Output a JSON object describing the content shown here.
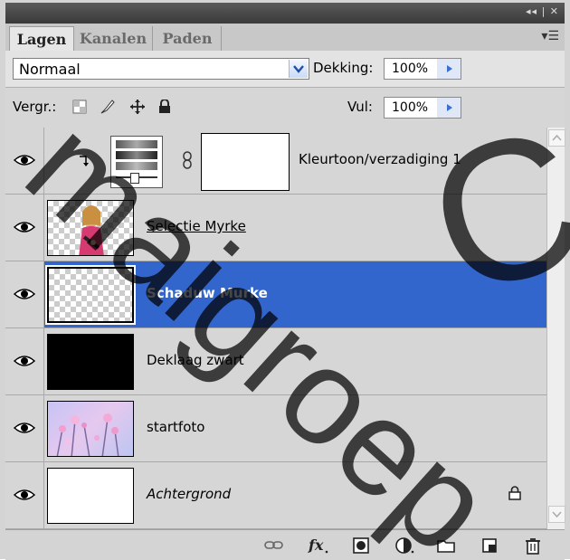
{
  "panel": {
    "tabs": [
      {
        "label": "Lagen"
      },
      {
        "label": "Kanalen"
      },
      {
        "label": "Paden"
      }
    ]
  },
  "options": {
    "blend_mode": "Normaal",
    "opacity_label": "Dekking:",
    "opacity_value": "100%",
    "lock_label": "Vergr.:",
    "fill_label": "Vul:",
    "fill_value": "100%"
  },
  "layers": [
    {
      "name": "Kleurtoon/verzadiging 1",
      "type": "adjustment",
      "visible": true
    },
    {
      "name": "Selectie Myrke",
      "type": "image",
      "visible": true
    },
    {
      "name": "Schaduw Murke",
      "type": "transparent",
      "visible": true,
      "selected": true
    },
    {
      "name": "Deklaag zwart",
      "type": "fill-black",
      "visible": true
    },
    {
      "name": "startfoto",
      "type": "photo",
      "visible": true
    },
    {
      "name": "Achtergrond",
      "type": "background",
      "visible": true,
      "locked": true
    }
  ],
  "watermark": {
    "text_left": "maigroep",
    "text_right": "Co"
  },
  "colors": {
    "selection": "#3366cc",
    "panel_bg": "#d6d6d6"
  }
}
